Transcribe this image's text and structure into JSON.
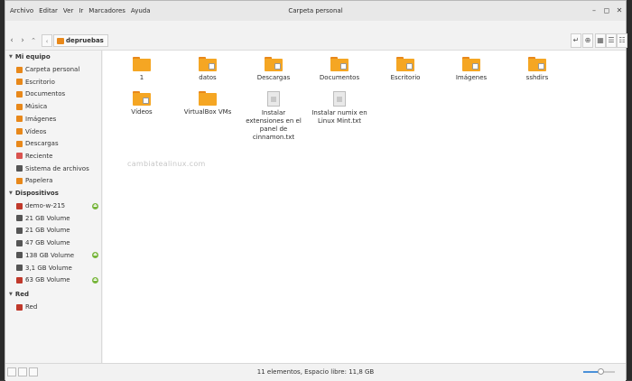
{
  "window": {
    "title": "Carpeta personal"
  },
  "menubar": [
    "Archivo",
    "Editar",
    "Ver",
    "Ir",
    "Marcadores",
    "Ayuda"
  ],
  "toolbar": {
    "location": "depruebas"
  },
  "sidebar": {
    "sections": [
      {
        "title": "Mi equipo",
        "items": [
          {
            "label": "Carpeta personal",
            "icon": "home-icon",
            "color": "#e8881a"
          },
          {
            "label": "Escritorio",
            "icon": "desktop-icon",
            "color": "#e8881a"
          },
          {
            "label": "Documentos",
            "icon": "documents-icon",
            "color": "#e8881a"
          },
          {
            "label": "Música",
            "icon": "music-icon",
            "color": "#e8881a"
          },
          {
            "label": "Imágenes",
            "icon": "images-icon",
            "color": "#e8881a"
          },
          {
            "label": "Vídeos",
            "icon": "videos-icon",
            "color": "#e8881a"
          },
          {
            "label": "Descargas",
            "icon": "downloads-icon",
            "color": "#e8881a"
          },
          {
            "label": "Reciente",
            "icon": "recent-icon",
            "color": "#d9534f"
          },
          {
            "label": "Sistema de archivos",
            "icon": "filesystem-icon",
            "color": "#555555"
          },
          {
            "label": "Papelera",
            "icon": "trash-icon",
            "color": "#e8881a"
          }
        ]
      },
      {
        "title": "Dispositivos",
        "items": [
          {
            "label": "demo-w-215",
            "icon": "usb-drive-icon",
            "color": "#c0392b",
            "eject": true
          },
          {
            "label": "21 GB Volume",
            "icon": "drive-icon",
            "color": "#555555"
          },
          {
            "label": "21 GB Volume",
            "icon": "drive-icon",
            "color": "#555555"
          },
          {
            "label": "47 GB Volume",
            "icon": "drive-icon",
            "color": "#555555"
          },
          {
            "label": "138 GB Volume",
            "icon": "drive-icon",
            "color": "#555555",
            "eject": true
          },
          {
            "label": "3,1 GB Volume",
            "icon": "drive-icon",
            "color": "#555555"
          },
          {
            "label": "63 GB Volume",
            "icon": "usb-drive-icon",
            "color": "#c0392b",
            "eject": true
          }
        ]
      },
      {
        "title": "Red",
        "items": [
          {
            "label": "Red",
            "icon": "network-icon",
            "color": "#c0392b"
          }
        ]
      }
    ]
  },
  "files": [
    {
      "name": "1",
      "type": "folder",
      "emblem": false
    },
    {
      "name": "datos",
      "type": "folder",
      "emblem": true
    },
    {
      "name": "Descargas",
      "type": "folder",
      "emblem": true
    },
    {
      "name": "Documentos",
      "type": "folder",
      "emblem": true
    },
    {
      "name": "Escritorio",
      "type": "folder",
      "emblem": true
    },
    {
      "name": "Imágenes",
      "type": "folder",
      "emblem": true
    },
    {
      "name": "sshdirs",
      "type": "folder",
      "emblem": true
    },
    {
      "name": "Vídeos",
      "type": "folder",
      "emblem": true
    },
    {
      "name": "VirtualBox VMs",
      "type": "folder",
      "emblem": false
    },
    {
      "name": "Instalar extensiones en el panel de cinnamon.txt",
      "type": "text"
    },
    {
      "name": "Instalar numix en Linux Mint.txt",
      "type": "text"
    }
  ],
  "watermark": "cambiatealinux.com",
  "statusbar": {
    "text": "11 elementos, Espacio libre: 11,8 GB",
    "zoom": 0.55
  },
  "colors": {
    "folder": "#f5a623",
    "folder_tab": "#e8881a",
    "accent": "#4a90d9",
    "eject": "#77b53b"
  }
}
